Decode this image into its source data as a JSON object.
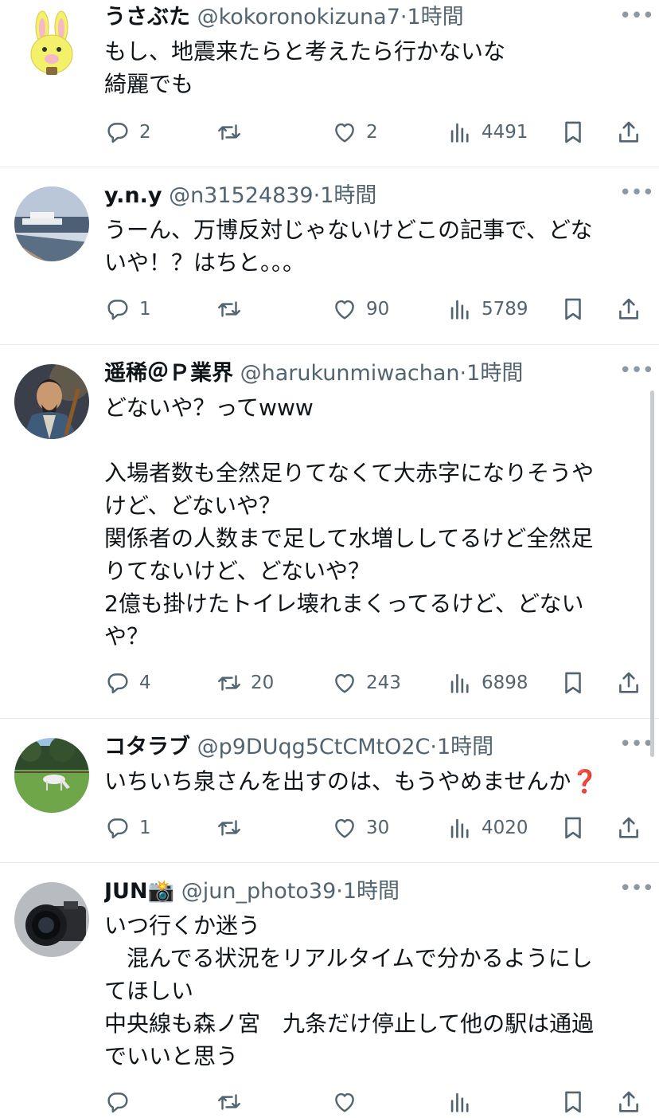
{
  "colors": {
    "text": "#0f1419",
    "secondary": "#536471",
    "divider": "#e6e9ec",
    "question_mark": "#e0245e"
  },
  "icons": {
    "reply": "reply-icon",
    "retweet": "retweet-icon",
    "like": "heart-icon",
    "views": "views-icon",
    "bookmark": "bookmark-icon",
    "share": "share-icon",
    "more": "more-icon"
  },
  "more_label": "•••",
  "dot": "·",
  "tweets": [
    {
      "name": "うさぶた",
      "handle": "@kokoronokizuna7",
      "time": "1時間",
      "lines": [
        "もし、地震来たらと考えたら行かないな",
        "綺麗でも"
      ],
      "replies": "2",
      "retweets": "",
      "likes": "2",
      "views": "4491"
    },
    {
      "name": "y.n.y",
      "handle": "@n31524839",
      "time": "1時間",
      "lines": [
        "うーん、万博反対じゃないけどこの記事で、どな",
        "いや！？はちと。。。"
      ],
      "replies": "1",
      "retweets": "",
      "likes": "90",
      "views": "5789"
    },
    {
      "name": "遥稀＠Ｐ業界",
      "handle": "@harukunmiwachan",
      "time": "1時間",
      "lines": [
        "どないや？ってwww",
        "",
        "入場者数も全然足りてなくて大赤字になりそうや",
        "けど、どないや？",
        "関係者の人数まで足して水増ししてるけど全然足",
        "りてないけど、どないや？",
        "2億も掛けたトイレ壊れまくってるけど、どない",
        "や？"
      ],
      "replies": "4",
      "retweets": "20",
      "likes": "243",
      "views": "6898"
    },
    {
      "name": "コタラブ",
      "handle": "@p9DUqg5CtCMtO2C",
      "time": "1時間",
      "lines": [
        "いちいち泉さんを出すのは、もうやめませんか"
      ],
      "emoji": "❓",
      "replies": "1",
      "retweets": "",
      "likes": "30",
      "views": "4020"
    },
    {
      "name": "JUN",
      "name_emoji": "📸",
      "handle": "@jun_photo39",
      "time": "1時間",
      "lines": [
        "いつ行くか迷う",
        "　混んでる状況をリアルタイムで分かるようにし",
        "てほしい",
        "中央線も森ノ宮　九条だけ停止して他の駅は通過",
        "でいいと思う"
      ],
      "replies": "",
      "retweets": "",
      "likes": "",
      "views": ""
    }
  ]
}
